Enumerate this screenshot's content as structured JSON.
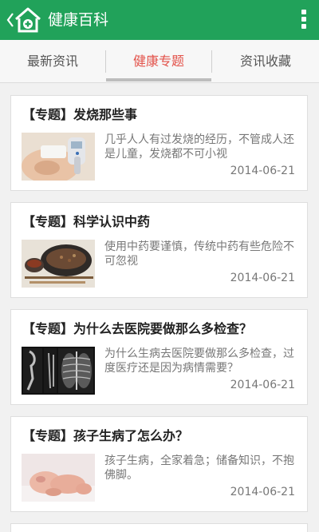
{
  "header": {
    "title": "健康百科",
    "logo_icon": "home-health-icon",
    "back_icon": "chevron-left-icon",
    "menu_icon": "overflow-menu-icon",
    "color": "#21a25a"
  },
  "tabs": [
    {
      "label": "最新资讯",
      "active": false
    },
    {
      "label": "健康专题",
      "active": true
    },
    {
      "label": "资讯收藏",
      "active": false
    }
  ],
  "articles": [
    {
      "title": "【专题】发烧那些事",
      "desc": "几乎人人有过发烧的经历，不管成人还是儿童，发烧都不可小视",
      "date": "2014-06-21",
      "thumb": "thermometer-photo"
    },
    {
      "title": "【专题】科学认识中药",
      "desc": "使用中药要谨慎，传统中药有些危险不可忽视",
      "date": "2014-06-21",
      "thumb": "herbal-medicine-photo"
    },
    {
      "title": "【专题】为什么去医院要做那么多检查？",
      "desc": "为什么生病去医院要做那么多检查，过度医疗还是因为病情需要？",
      "date": "2014-06-21",
      "thumb": "xray-photo"
    },
    {
      "title": "【专题】孩子生病了怎么办？",
      "desc": "孩子生病，全家着急；储备知识，不抱佛脚。",
      "date": "2014-06-21",
      "thumb": "baby-photo"
    }
  ],
  "accent_color": "#e3524a"
}
